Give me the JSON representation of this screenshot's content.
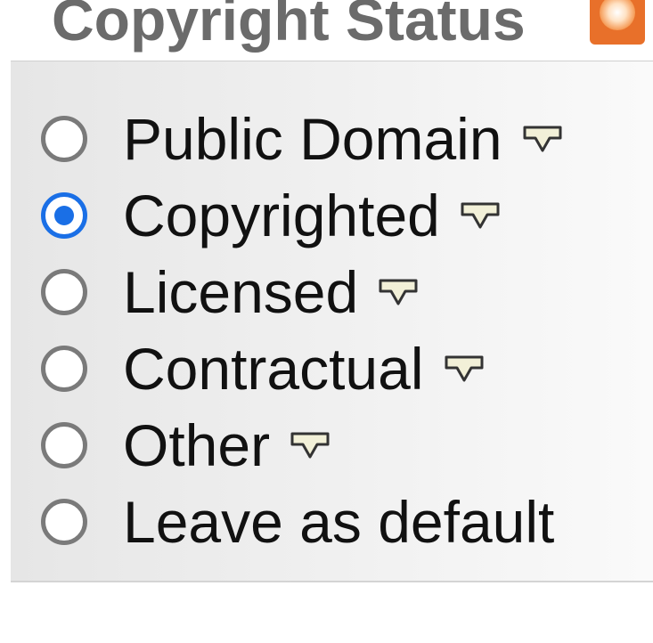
{
  "fieldset": {
    "legend": "Copyright Status",
    "legend_icon": "rss-feed-icon"
  },
  "options": [
    {
      "label": "Public Domain",
      "checked": false,
      "has_help": true
    },
    {
      "label": "Copyrighted",
      "checked": true,
      "has_help": true
    },
    {
      "label": "Licensed",
      "checked": false,
      "has_help": true
    },
    {
      "label": "Contractual",
      "checked": false,
      "has_help": true
    },
    {
      "label": "Other",
      "checked": false,
      "has_help": true
    },
    {
      "label": "Leave as default",
      "checked": false,
      "has_help": false
    }
  ],
  "colors": {
    "accent": "#1a6fe6",
    "legend_text": "#6b6b6b",
    "rss_icon": "#e8702a",
    "help_icon_fill": "#f2f0d8"
  },
  "help_icon": "speech-bubble-help-icon"
}
